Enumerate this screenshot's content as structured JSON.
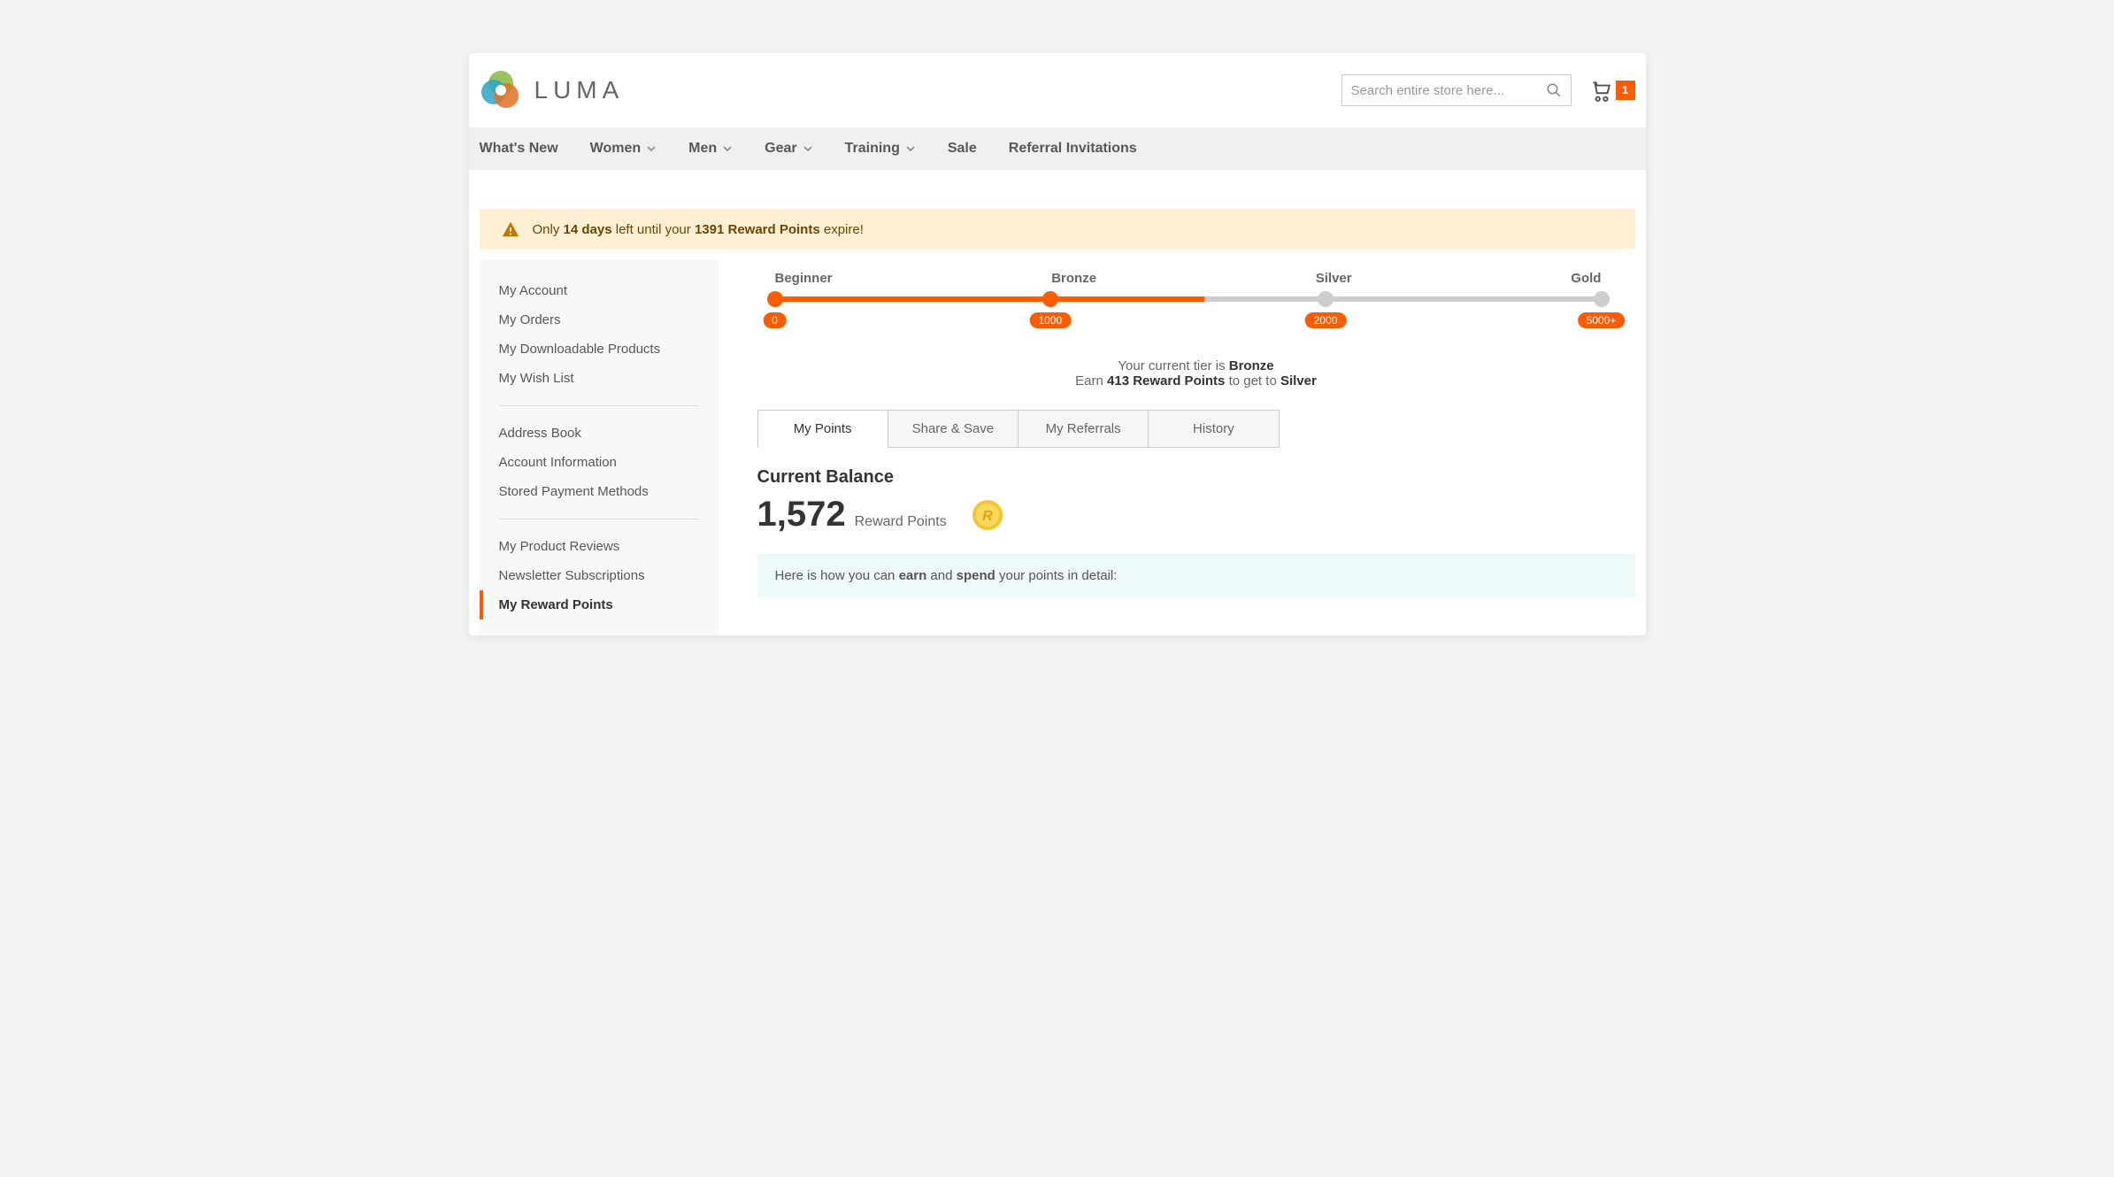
{
  "brand": {
    "name": "LUMA"
  },
  "search": {
    "placeholder": "Search entire store here..."
  },
  "cart": {
    "count": "1"
  },
  "nav": {
    "items": [
      {
        "label": "What's New",
        "dropdown": false
      },
      {
        "label": "Women",
        "dropdown": true
      },
      {
        "label": "Men",
        "dropdown": true
      },
      {
        "label": "Gear",
        "dropdown": true
      },
      {
        "label": "Training",
        "dropdown": true
      },
      {
        "label": "Sale",
        "dropdown": false
      },
      {
        "label": "Referral Invitations",
        "dropdown": false
      }
    ]
  },
  "alert": {
    "prefix": "Only ",
    "days": "14 days",
    "mid": " left until your ",
    "points": "1391 Reward Points",
    "suffix": " expire!"
  },
  "sidebar": {
    "groups": [
      [
        "My Account",
        "My Orders",
        "My Downloadable Products",
        "My Wish List"
      ],
      [
        "Address Book",
        "Account Information",
        "Stored Payment Methods"
      ],
      [
        "My Product Reviews",
        "Newsletter Subscriptions",
        "My Reward Points"
      ]
    ],
    "active": "My Reward Points"
  },
  "tiers": {
    "levels": [
      {
        "name": "Beginner",
        "value": "0",
        "pos": 0
      },
      {
        "name": "Bronze",
        "value": "1000",
        "pos": 33.33
      },
      {
        "name": "Silver",
        "value": "2000",
        "pos": 66.66
      },
      {
        "name": "Gold",
        "value": "5000+",
        "pos": 100
      }
    ],
    "progress_percent": 52,
    "status_prefix": "Your current tier is ",
    "current_tier": "Bronze",
    "next_prefix": "Earn ",
    "next_points": "413 Reward Points",
    "next_mid": " to get to ",
    "next_tier": "Silver"
  },
  "tabs": {
    "items": [
      "My Points",
      "Share & Save",
      "My Referrals",
      "History"
    ],
    "active": "My Points"
  },
  "balance": {
    "title": "Current Balance",
    "value": "1,572",
    "unit": "Reward Points"
  },
  "info": {
    "prefix": "Here is how you can ",
    "earn": "earn",
    "mid": " and ",
    "spend": "spend",
    "suffix": " your points in detail:"
  }
}
